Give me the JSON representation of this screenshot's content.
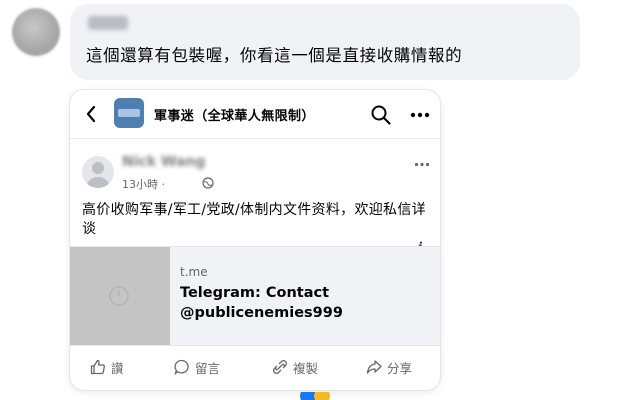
{
  "comment": {
    "text": "這個還算有包裝喔，你看這一個是直接收購情報的"
  },
  "embedded_post": {
    "page_title": "軍事迷（全球華人無限制）",
    "post": {
      "author": "Nick Wang",
      "time": "13小時 ·",
      "text": "高价收购军事/军工/党政/体制内文件资料，欢迎私信详谈"
    },
    "link": {
      "domain": "t.me",
      "title": "Telegram: Contact @publicenemies999",
      "info_glyph": "i"
    },
    "actions": {
      "like": "讚",
      "comment": "留言",
      "share": "複製",
      "send": "分享"
    }
  },
  "colors": {
    "bubble": "#f0f2f5",
    "secondary_text": "#65676b",
    "page_avatar": "#4e7fb3"
  }
}
